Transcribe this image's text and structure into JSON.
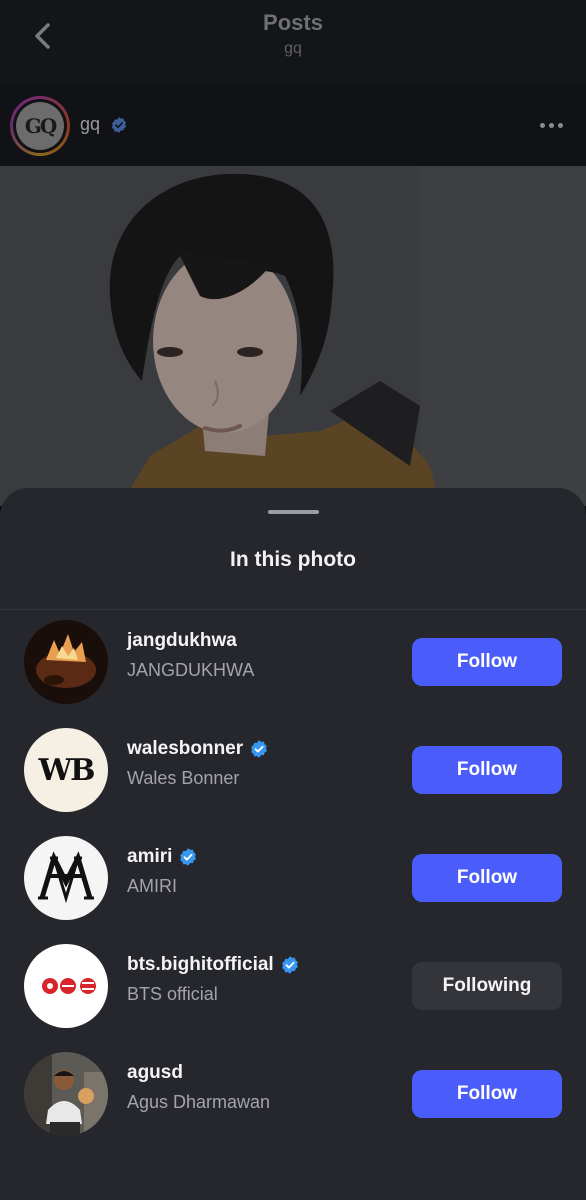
{
  "header": {
    "title": "Posts",
    "subtitle": "gq"
  },
  "post": {
    "username": "gq",
    "verified": true,
    "avatar_text": "GQ"
  },
  "sheet": {
    "title": "In this photo",
    "people": [
      {
        "username": "jangdukhwa",
        "name": "JANGDUKHWA",
        "verified": false,
        "button": "Follow",
        "following": false
      },
      {
        "username": "walesbonner",
        "name": "Wales Bonner",
        "verified": true,
        "button": "Follow",
        "following": false,
        "avatar_text": "WB"
      },
      {
        "username": "amiri",
        "name": "AMIRI",
        "verified": true,
        "button": "Follow",
        "following": false
      },
      {
        "username": "bts.bighitofficial",
        "name": "BTS official",
        "verified": true,
        "button": "Following",
        "following": true
      },
      {
        "username": "agusd",
        "name": "Agus Dharmawan",
        "verified": false,
        "button": "Follow",
        "following": false
      }
    ]
  },
  "colors": {
    "accent": "#4a5dfb",
    "verified": "#3797f0",
    "sheet": "#26272c"
  }
}
